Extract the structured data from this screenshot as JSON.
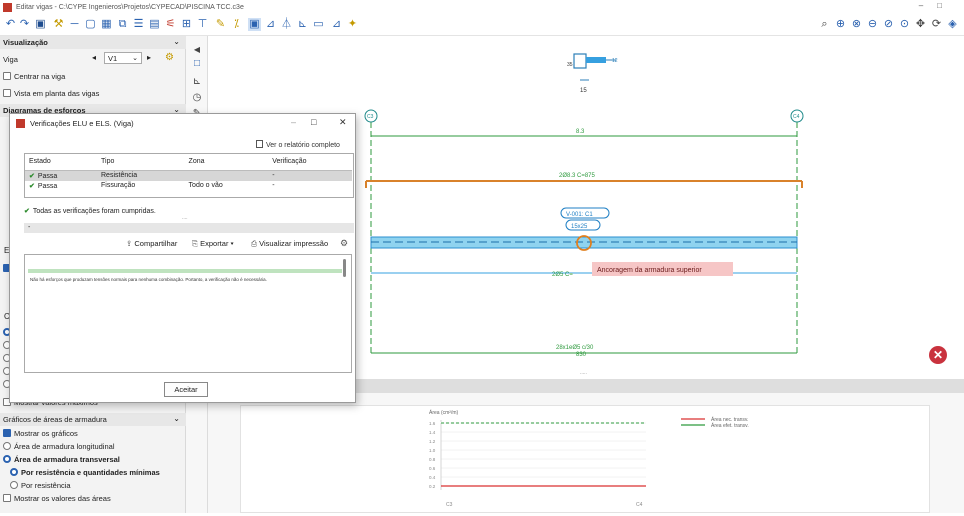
{
  "window": {
    "title": "Editar vigas - C:\\CYPE Ingenieros\\Projetos\\CYPECAD\\PISCINA TCC.c3e",
    "controls": [
      "–",
      "□"
    ]
  },
  "left_panel": {
    "visualizacao_header": "Visualização",
    "viga_label": "Viga",
    "viga_value": "V1",
    "centrar_na_viga": "Centrar na viga",
    "vista_planta": "Vista em planta das vigas",
    "diagramas_header": "Diagramas de esforços",
    "mostrar_valores_maximos": "Mostrar valores máximos",
    "graficos_header": "Gráficos de áreas de armadura",
    "mostrar_graficos": "Mostrar os gráficos",
    "area_long": "Área de armadura longitudinal",
    "area_transv": "Área de armadura transversal",
    "por_resist_quant": "Por resistência e quantidades mínimas",
    "por_resist": "Por resistência",
    "mostrar_valores_areas": "Mostrar os valores das áreas"
  },
  "dialog": {
    "title": "Verificações ELU e ELS. (Viga)",
    "report_button": "Ver o relatório completo",
    "columns": [
      "Estado",
      "Tipo",
      "Zona",
      "Verificação"
    ],
    "rows": [
      {
        "estado": "Passa",
        "tipo": "Resistência",
        "zona": "",
        "verificacao": "-"
      },
      {
        "estado": "Passa",
        "tipo": "Fissuração",
        "zona": "Todo o vão",
        "verificacao": "-"
      }
    ],
    "all_passed": "Todas as verificações foram cumpridas.",
    "dots": "....",
    "share": "Compartilhar",
    "export": "Exportar",
    "print_preview": "Visualizar impressão",
    "detail_text": "Não há esforços que produzam tensões normais para nenhuma combinação. Portanto, a verificação não é necessária.",
    "accept": "Aceitar"
  },
  "drawing": {
    "section_dim_h": "35",
    "section_dim_w": "15",
    "section_note": "12",
    "support_left": "C3",
    "support_right": "C4",
    "span_top": "8.3",
    "top_bar": "2Ø8.3 C=875",
    "beam_tag": "V-001: C1",
    "beam_section": "15x25",
    "bottom_bar_prefix": "2Ø5 C=",
    "tooltip": "Ancoragem da armadura superior",
    "stirrups": "28x1eØ5 c/30",
    "stirrups_len": "830",
    "sep_dots": "....."
  },
  "graph": {
    "title": "Área (cm²/m)",
    "legend": [
      "Área nec. transv.",
      "Área efet. transv."
    ],
    "y_ticks": [
      "1.6",
      "1.4",
      "1.2",
      "1.0",
      "0.8",
      "0.6",
      "0.4",
      "0.2"
    ],
    "x_labels": [
      "C3",
      "C4"
    ],
    "colors": {
      "required": "#d93030",
      "provided": "#2e9a3e"
    }
  }
}
